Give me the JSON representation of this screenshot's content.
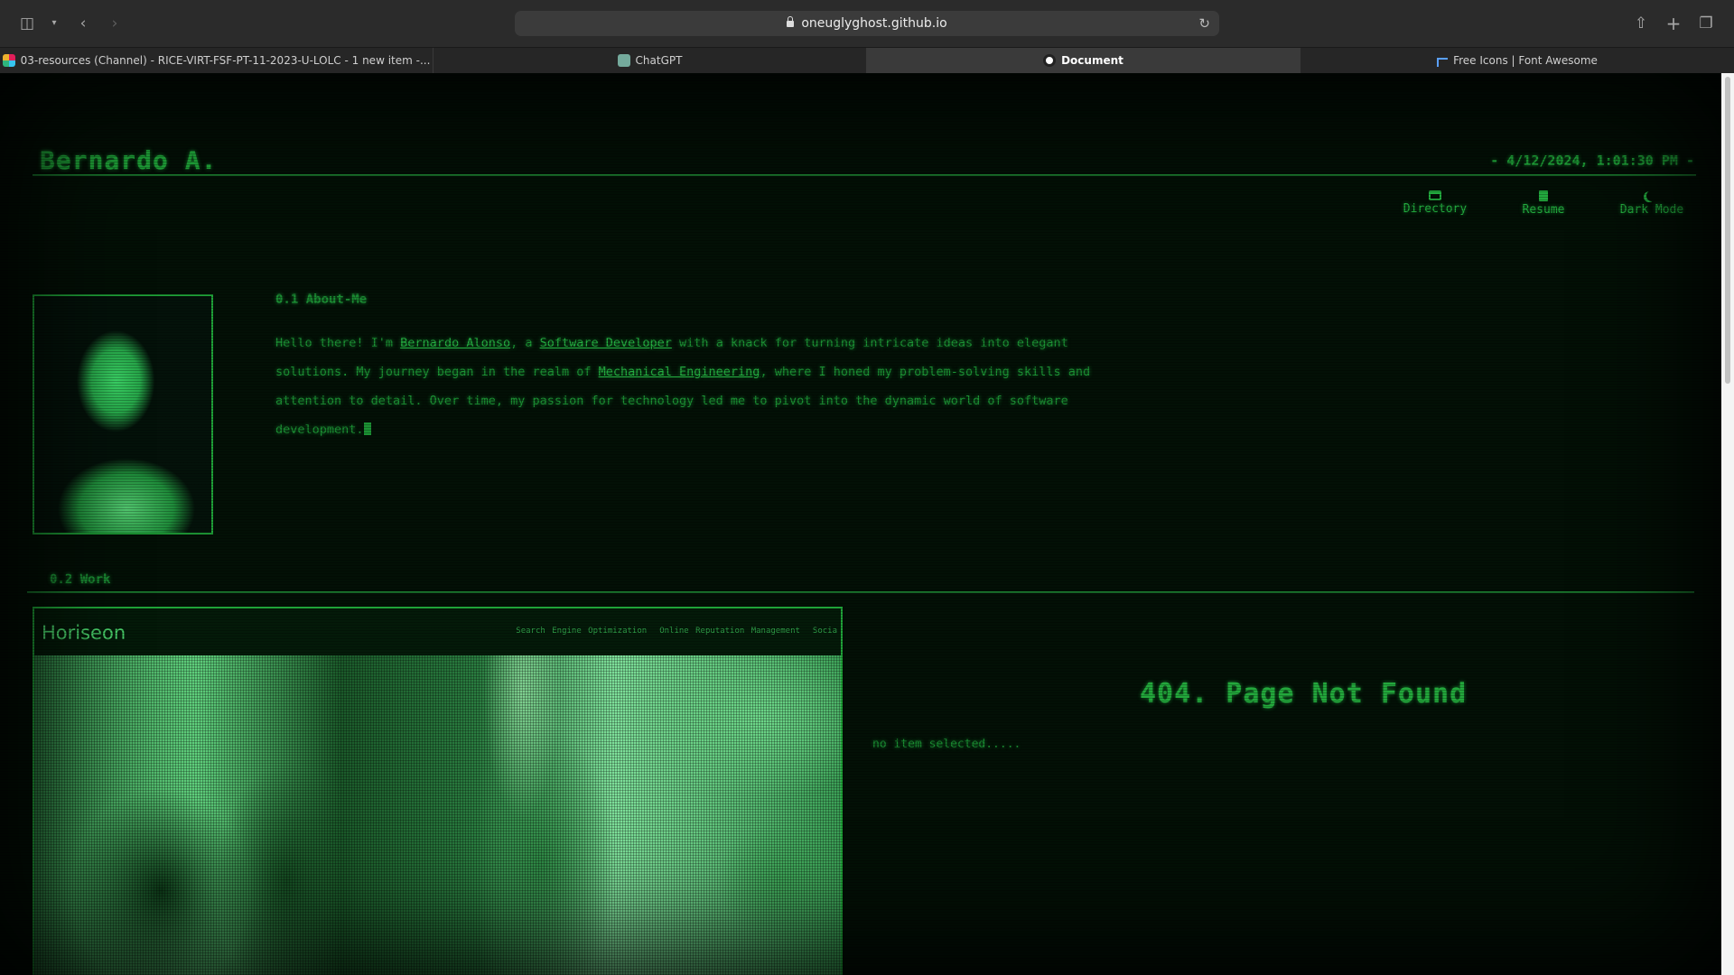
{
  "browser": {
    "url": "oneuglyghost.github.io",
    "tabs": [
      {
        "label": "03-resources (Channel) - RICE-VIRT-FSF-PT-11-2023-U-LOLC - 1 new item -...",
        "icon": "slack-icon",
        "active": false
      },
      {
        "label": "ChatGPT",
        "icon": "chatgpt-icon",
        "active": false
      },
      {
        "label": "Document",
        "icon": "github-icon",
        "active": true
      },
      {
        "label": "Free Icons | Font Awesome",
        "icon": "flag-icon",
        "active": false
      }
    ]
  },
  "header": {
    "site_name": "Bernardo A.",
    "datetime": "- 4/12/2024, 1:01:30 PM -"
  },
  "nav": [
    {
      "label": "Directory",
      "icon": "folder-open-icon"
    },
    {
      "label": "Resume",
      "icon": "file-icon"
    },
    {
      "label": "Dark Mode",
      "icon": "moon-icon"
    }
  ],
  "about": {
    "title": "0.1 About-Me",
    "text_1": "Hello there! I'm ",
    "link_name": "Bernardo Alonso",
    "text_2": ", a ",
    "link_role": "Software Developer",
    "text_3": " with a knack for turning intricate ideas into elegant solutions. My journey began in the realm of ",
    "link_field": "Mechanical Engineering",
    "text_4": ", where I honed my problem-solving skills and attention to detail. Over time, my passion for technology led me to pivot into the dynamic world of software development."
  },
  "work": {
    "title": "0.2 Work",
    "preview": {
      "logo": "Horiseon",
      "links": [
        "Search Engine Optimization",
        "Online Reputation Management",
        "Socia"
      ]
    },
    "detail_title": "404. Page Not Found",
    "detail_text": "no item selected....."
  },
  "colors": {
    "terminal_green": "#1fa338",
    "background": "#031006"
  }
}
